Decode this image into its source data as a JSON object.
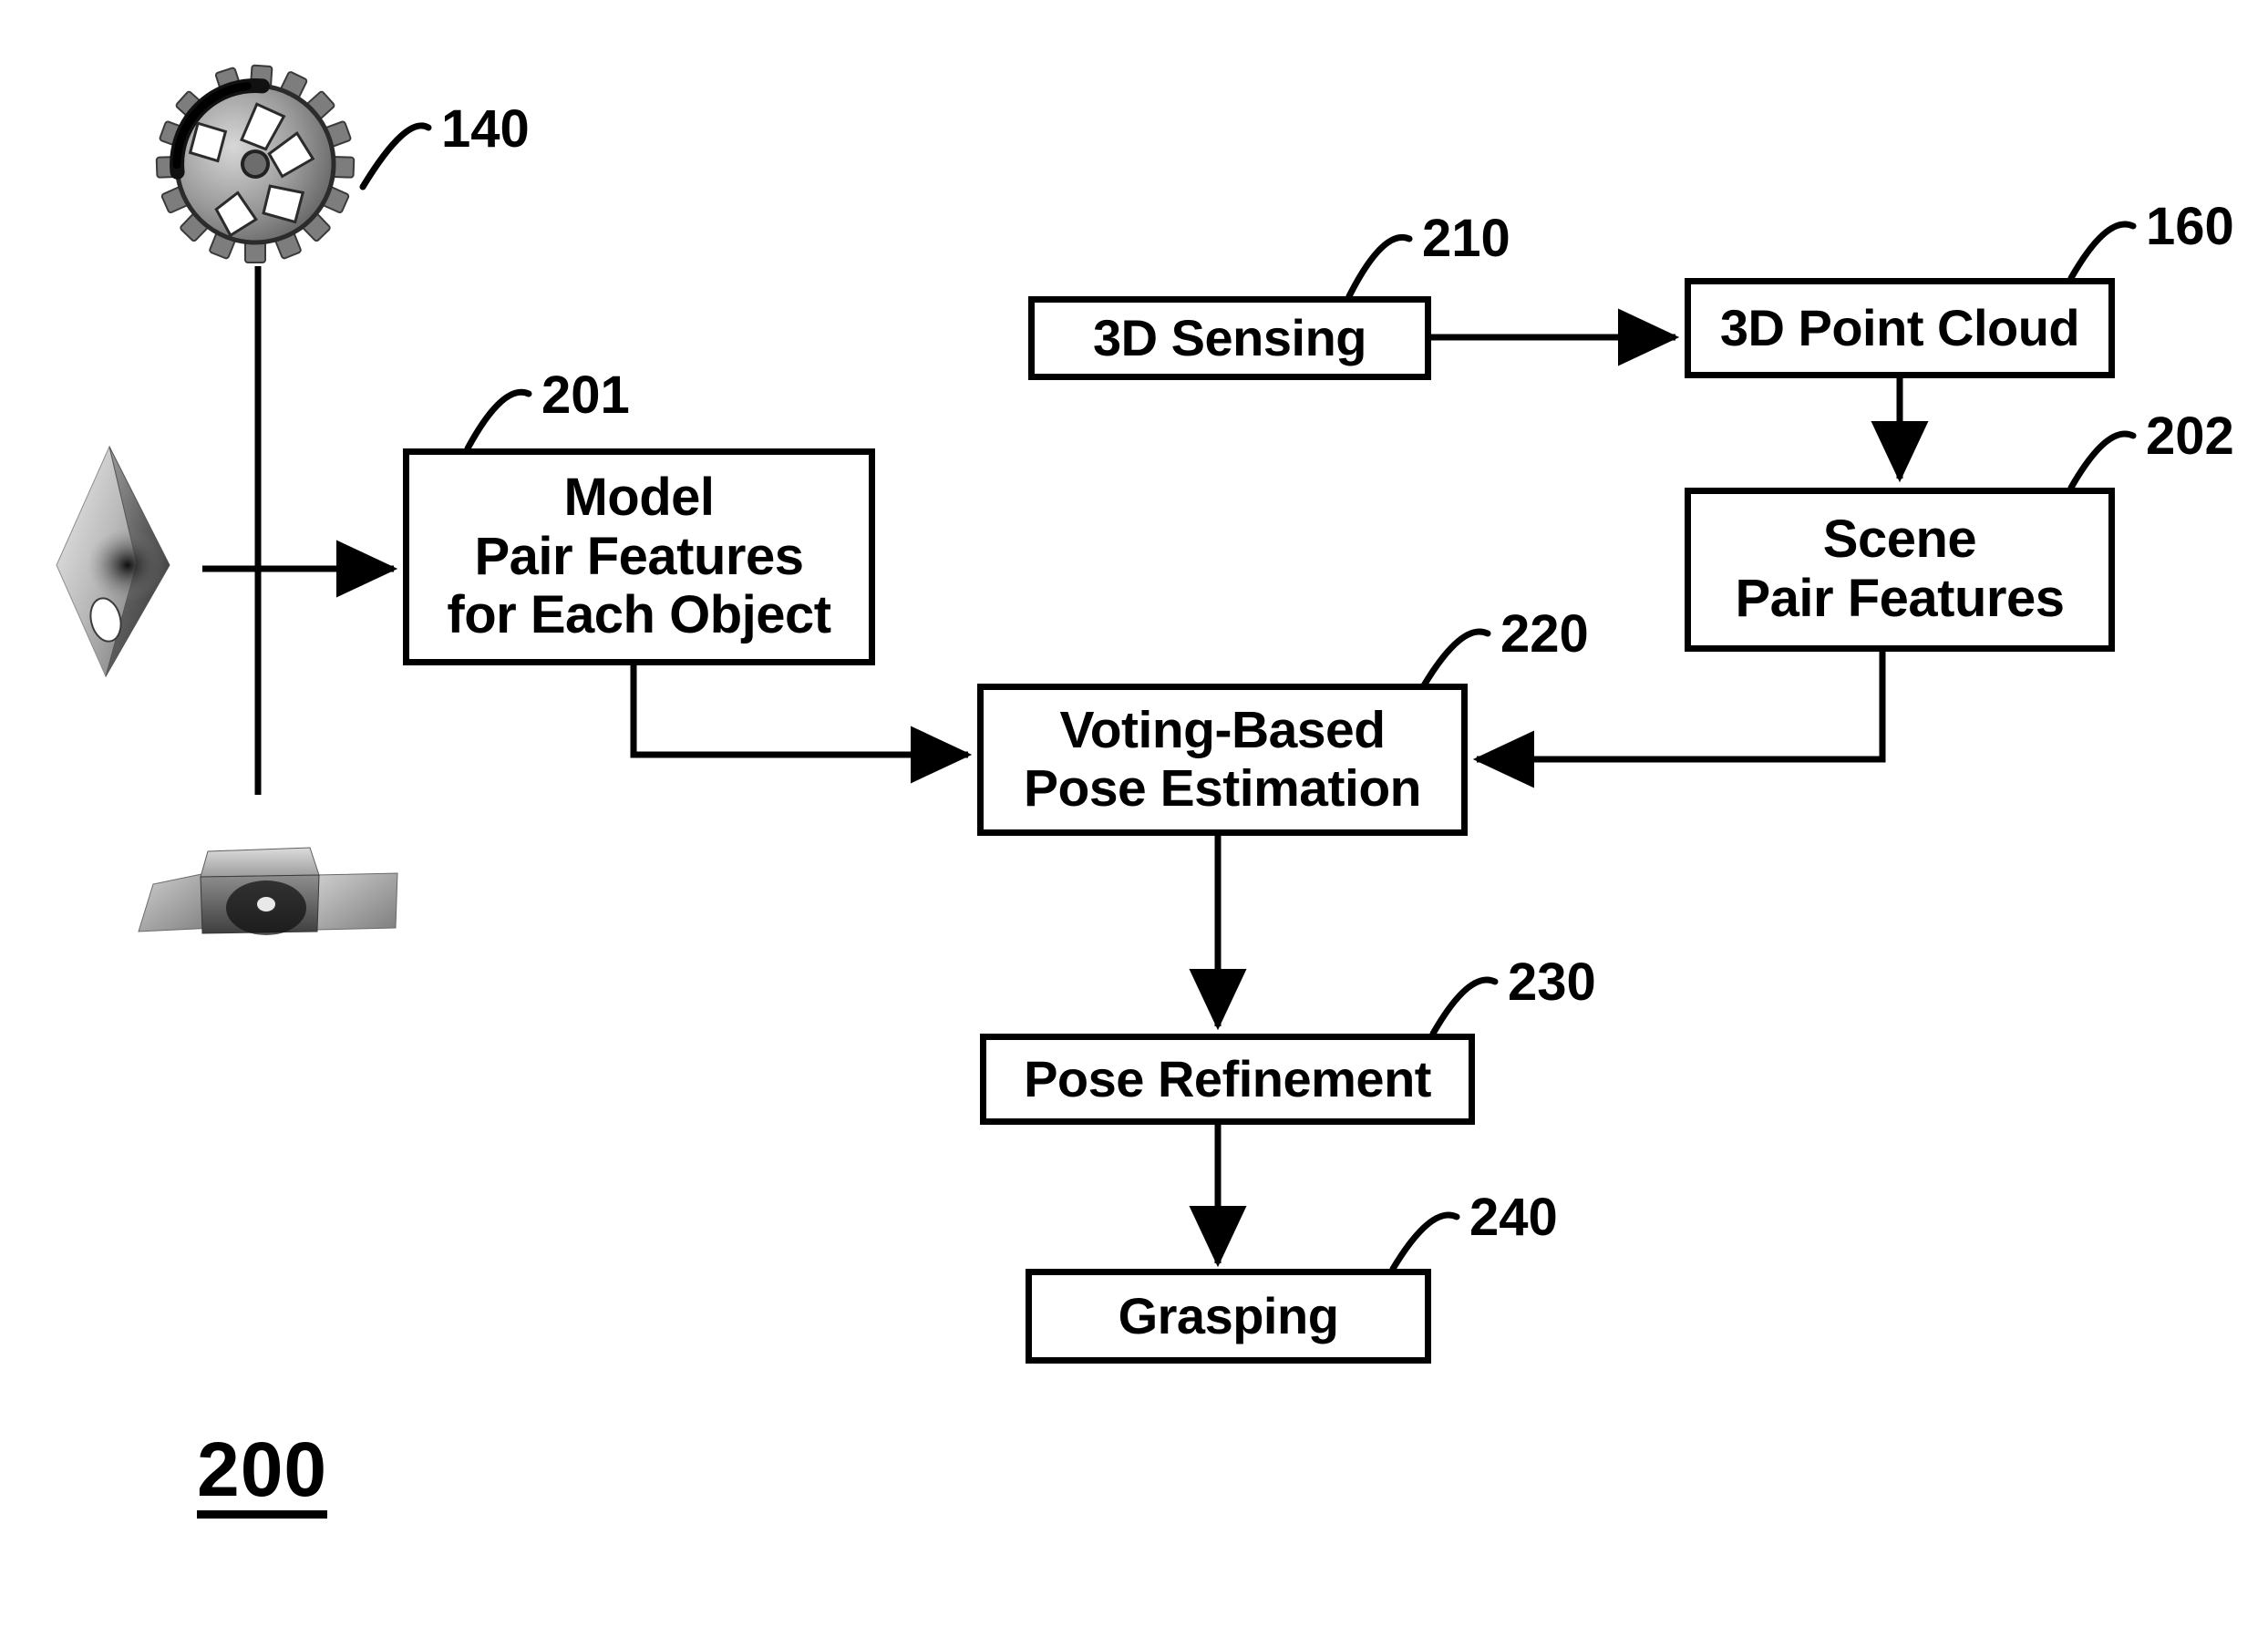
{
  "figure": {
    "number": "200",
    "title_label": "200"
  },
  "objects": [
    {
      "id": "gear-object",
      "name": "gear-sprocket-3d-model",
      "ref": "140"
    },
    {
      "id": "diamond-object",
      "name": "rhombus-plate-3d-model",
      "ref": ""
    },
    {
      "id": "bracket-object",
      "name": "mechanical-bracket-3d-model",
      "ref": ""
    }
  ],
  "boxes": {
    "model_pair_features": {
      "ref": "201",
      "lines": [
        "Model",
        "Pair Features",
        "for Each Object"
      ]
    },
    "sensing": {
      "ref": "210",
      "lines": [
        "3D Sensing"
      ]
    },
    "point_cloud": {
      "ref": "160",
      "lines": [
        "3D Point Cloud"
      ]
    },
    "scene_pair_features": {
      "ref": "202",
      "lines": [
        "Scene",
        "Pair Features"
      ]
    },
    "voting_pose_estimation": {
      "ref": "220",
      "lines": [
        "Voting-Based",
        "Pose Estimation"
      ]
    },
    "pose_refinement": {
      "ref": "230",
      "lines": [
        "Pose Refinement"
      ]
    },
    "grasping": {
      "ref": "240",
      "lines": [
        "Grasping"
      ]
    }
  },
  "colors": {
    "ink": "#000000",
    "paper": "#ffffff"
  }
}
